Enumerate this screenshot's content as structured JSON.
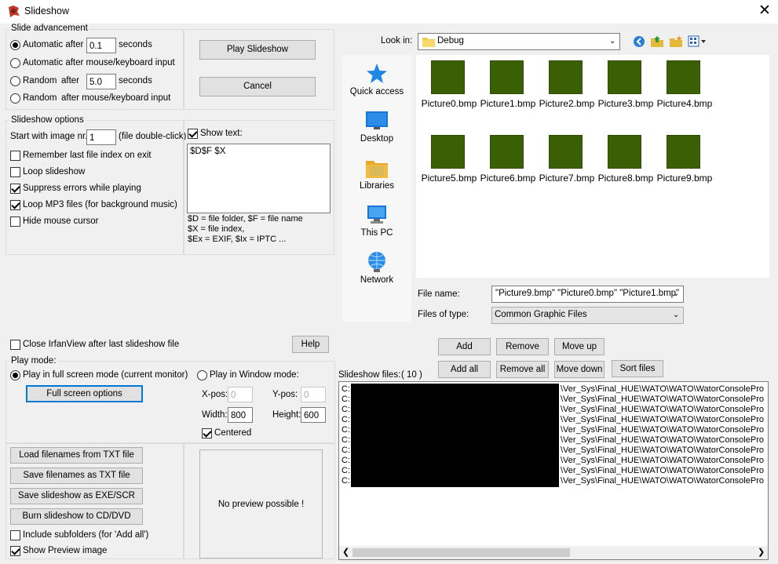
{
  "window": {
    "title": "Slideshow"
  },
  "slide_advancement": {
    "title": "Slide advancement",
    "options": [
      {
        "label": "Automatic after",
        "value": "0.1",
        "suffix": "seconds",
        "checked": true
      },
      {
        "label": "Automatic after mouse/keyboard input",
        "checked": false
      },
      {
        "label": "Random",
        "label2": "after",
        "value": "5.0",
        "suffix": "seconds",
        "checked": false
      },
      {
        "label": "Random",
        "label2": "after mouse/keyboard input",
        "checked": false
      }
    ]
  },
  "buttons": {
    "play": "Play Slideshow",
    "cancel": "Cancel",
    "help": "Help",
    "full_screen_options": "Full screen options",
    "load_txt": "Load filenames from TXT file",
    "save_txt": "Save filenames as TXT file",
    "save_exe": "Save slideshow as  EXE/SCR",
    "burn": "Burn slideshow to CD/DVD",
    "add": "Add",
    "remove": "Remove",
    "move_up": "Move up",
    "add_all": "Add all",
    "remove_all": "Remove all",
    "move_down": "Move down",
    "sort_files": "Sort files"
  },
  "slideshow_options": {
    "title": "Slideshow options",
    "start_label": "Start with image nr.:",
    "start_value": "1",
    "start_hint": "(file double-click)",
    "checks": [
      {
        "label": "Remember last file index on exit",
        "checked": false
      },
      {
        "label": "Loop slideshow",
        "checked": false
      },
      {
        "label": "Suppress errors while playing",
        "checked": true
      },
      {
        "label": "Loop MP3 files (for background music)",
        "checked": true
      },
      {
        "label": "Hide mouse cursor",
        "checked": false
      }
    ],
    "show_text_label": "Show text:",
    "show_text_checked": true,
    "show_text_value": "$D$F $X",
    "help_lines": [
      "$D = file folder, $F = file name",
      "$X = file index,",
      "$Ex = EXIF, $Ix = IPTC ..."
    ]
  },
  "close_after_label": "Close IrfanView after last slideshow file",
  "play_mode": {
    "title": "Play mode:",
    "full_screen_label": "Play in full screen mode (current monitor)",
    "window_label": "Play in Window mode:",
    "xpos_label": "X-pos:",
    "xpos_value": "0",
    "ypos_label": "Y-pos:",
    "ypos_value": "0",
    "width_label": "Width:",
    "width_value": "800",
    "height_label": "Height:",
    "height_value": "600",
    "centered_label": "Centered"
  },
  "include_subfolders_label": "Include subfolders (for 'Add all')",
  "show_preview_label": "Show Preview image",
  "preview_text": "No preview possible !",
  "file_dialog": {
    "look_in_label": "Look in:",
    "look_in_value": "Debug",
    "places": [
      "Quick access",
      "Desktop",
      "Libraries",
      "This PC",
      "Network"
    ],
    "files": [
      "Picture0.bmp",
      "Picture1.bmp",
      "Picture2.bmp",
      "Picture3.bmp",
      "Picture4.bmp",
      "Picture5.bmp",
      "Picture6.bmp",
      "Picture7.bmp",
      "Picture8.bmp",
      "Picture9.bmp"
    ],
    "file_name_label": "File name:",
    "file_name_value": "\"Picture9.bmp\" \"Picture0.bmp\" \"Picture1.bmp\"",
    "files_of_type_label": "Files of type:",
    "files_of_type_value": "Common Graphic Files"
  },
  "slideshow_files": {
    "label": "Slideshow files:",
    "count": "( 10 )",
    "rows": [
      {
        "prefix": "C:",
        "path": "\\Ver_Sys\\Final_HUE\\WATO\\WATO\\WatorConsolePro"
      },
      {
        "prefix": "C:",
        "path": "\\Ver_Sys\\Final_HUE\\WATO\\WATO\\WatorConsolePro"
      },
      {
        "prefix": "C:",
        "path": "\\Ver_Sys\\Final_HUE\\WATO\\WATO\\WatorConsolePro"
      },
      {
        "prefix": "C:",
        "path": "\\Ver_Sys\\Final_HUE\\WATO\\WATO\\WatorConsolePro"
      },
      {
        "prefix": "C:",
        "path": "\\Ver_Sys\\Final_HUE\\WATO\\WATO\\WatorConsolePro"
      },
      {
        "prefix": "C:",
        "path": "\\Ver_Sys\\Final_HUE\\WATO\\WATO\\WatorConsolePro"
      },
      {
        "prefix": "C:",
        "path": "\\Ver_Sys\\Final_HUE\\WATO\\WATO\\WatorConsolePro"
      },
      {
        "prefix": "C:",
        "path": "\\Ver_Sys\\Final_HUE\\WATO\\WATO\\WatorConsolePro"
      },
      {
        "prefix": "C:",
        "path": "\\Ver_Sys\\Final_HUE\\WATO\\WATO\\WatorConsolePro"
      },
      {
        "prefix": "C:",
        "path": "\\Ver_Sys\\Final_HUE\\WATO\\WATO\\WatorConsolePro"
      }
    ]
  },
  "colors": {
    "thumbnail": "#3a5f05",
    "accent": "#0078d7",
    "redaction": "#000000"
  },
  "icons": [
    "slideshow-app-icon",
    "close-icon",
    "folder-icon",
    "back-icon",
    "up-folder-icon",
    "new-folder-icon",
    "view-menu-icon",
    "quick-access-icon",
    "desktop-icon",
    "libraries-icon",
    "this-pc-icon",
    "network-icon",
    "scroll-left-icon",
    "scroll-right-icon"
  ]
}
